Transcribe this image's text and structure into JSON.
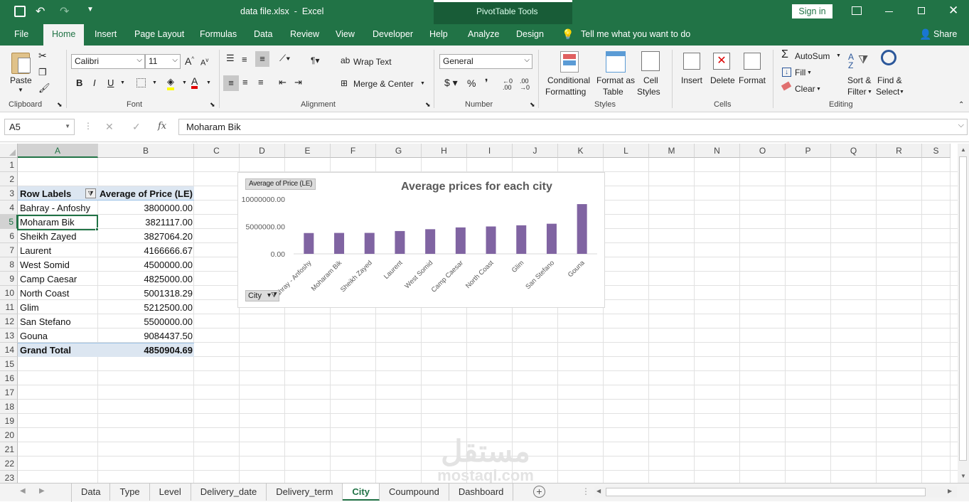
{
  "titlebar": {
    "file_title": "data file.xlsx  -  Excel",
    "context_tools": "PivotTable Tools",
    "sign_in": "Sign in"
  },
  "tabs": [
    "File",
    "Home",
    "Insert",
    "Page Layout",
    "Formulas",
    "Data",
    "Review",
    "View",
    "Developer",
    "Help",
    "Analyze",
    "Design"
  ],
  "tell_me": "Tell me what you want to do",
  "share": "Share",
  "ribbon": {
    "clipboard": {
      "paste": "Paste",
      "label": "Clipboard"
    },
    "font": {
      "name": "Calibri",
      "size": "11",
      "label": "Font"
    },
    "alignment": {
      "wrap_text": "Wrap Text",
      "merge_center": "Merge & Center",
      "label": "Alignment"
    },
    "number": {
      "format": "General",
      "label": "Number"
    },
    "styles": {
      "conditional_1": "Conditional",
      "conditional_2": "Formatting",
      "format_as_1": "Format as",
      "format_as_2": "Table",
      "cell_1": "Cell",
      "cell_2": "Styles",
      "label": "Styles"
    },
    "cells": {
      "insert": "Insert",
      "delete": "Delete",
      "format": "Format",
      "label": "Cells"
    },
    "editing": {
      "autosum": "AutoSum",
      "fill": "Fill",
      "clear": "Clear",
      "sort_1": "Sort &",
      "sort_2": "Filter",
      "find_1": "Find &",
      "find_2": "Select",
      "label": "Editing"
    }
  },
  "formula_bar": {
    "name_box": "A5",
    "fx": "fx",
    "content": "Moharam Bik"
  },
  "columns": [
    "A",
    "B",
    "C",
    "D",
    "E",
    "F",
    "G",
    "H",
    "I",
    "J",
    "K",
    "L",
    "M",
    "N",
    "O",
    "P",
    "Q",
    "R",
    "S"
  ],
  "rows": [
    "1",
    "2",
    "3",
    "4",
    "5",
    "6",
    "7",
    "8",
    "9",
    "10",
    "11",
    "12",
    "13",
    "14",
    "15",
    "16",
    "17",
    "18",
    "19",
    "20",
    "21",
    "22",
    "23"
  ],
  "pivot": {
    "header_a": "Row Labels",
    "header_b": "Average of Price (LE)",
    "rows": [
      {
        "city": "Bahray - Anfoshy",
        "value": "3800000.00"
      },
      {
        "city": "Moharam Bik",
        "value": "3821117.00"
      },
      {
        "city": "Sheikh Zayed",
        "value": "3827064.20"
      },
      {
        "city": "Laurent",
        "value": "4166666.67"
      },
      {
        "city": "West Somid",
        "value": "4500000.00"
      },
      {
        "city": "Camp Caesar",
        "value": "4825000.00"
      },
      {
        "city": "North Coast",
        "value": "5001318.29"
      },
      {
        "city": "Glim",
        "value": "5212500.00"
      },
      {
        "city": "San Stefano",
        "value": "5500000.00"
      },
      {
        "city": "Gouna",
        "value": "9084437.50"
      }
    ],
    "total_label": "Grand Total",
    "total_value": "4850904.69"
  },
  "chart_data": {
    "type": "bar",
    "title": "Average prices for each city",
    "value_field_button": "Average of Price (LE)",
    "axis_field_button": "City",
    "categories": [
      "Bahray - Anfoshy",
      "Moharam Bik",
      "Sheikh Zayed",
      "Laurent",
      "West Somid",
      "Camp Caesar",
      "North Coast",
      "Glim",
      "San Stefano",
      "Gouna"
    ],
    "values": [
      3800000,
      3821117,
      3827064.2,
      4166666.67,
      4500000,
      4825000,
      5001318.29,
      5212500,
      5500000,
      9084437.5
    ],
    "yticks": [
      "0.00",
      "5000000.00",
      "10000000.00"
    ],
    "ylim": [
      0,
      10000000
    ],
    "bar_color": "#8064a2",
    "legend": "none",
    "grid": false
  },
  "sheets": [
    "Data",
    "Type",
    "Level",
    "Delivery_date",
    "Delivery_term",
    "City",
    "Coumpound",
    "Dashboard"
  ],
  "active_sheet": "City",
  "watermark": "mostaql.com",
  "colors": {
    "excel_green": "#217346",
    "pivot_header": "#dce6f1",
    "bar": "#8064a2"
  }
}
